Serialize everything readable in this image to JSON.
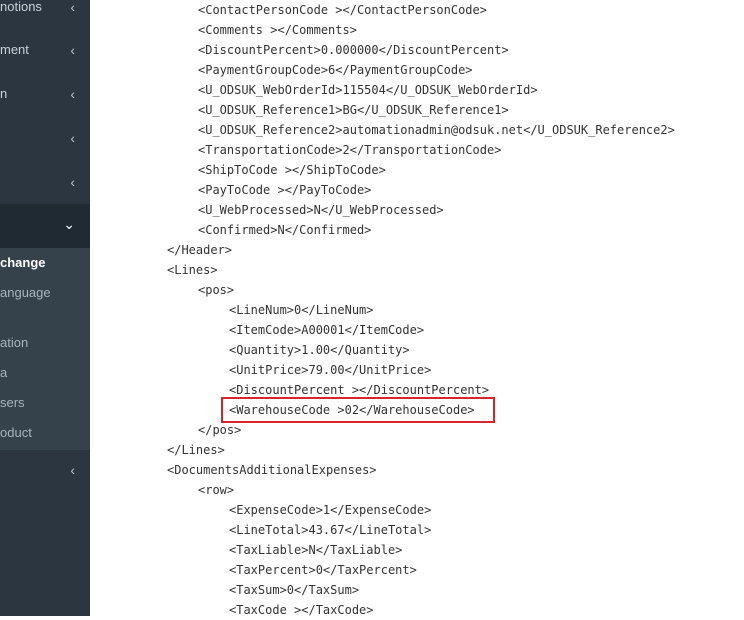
{
  "sidebar": {
    "items": [
      {
        "label": "notions"
      },
      {
        "label": "ment"
      },
      {
        "label": "n"
      },
      {
        "label": ""
      },
      {
        "label": ""
      },
      {
        "label": ""
      },
      {
        "label": ""
      }
    ],
    "submenu": [
      {
        "label": "change"
      },
      {
        "label": "anguage"
      },
      {
        "label": "ation"
      },
      {
        "label": "a"
      },
      {
        "label": "sers"
      },
      {
        "label": "oduct"
      }
    ]
  },
  "code_lines": [
    "<ContactPersonCode ></ContactPersonCode>",
    "<Comments ></Comments>",
    "<DiscountPercent>0.000000</DiscountPercent>",
    "<PaymentGroupCode>6</PaymentGroupCode>",
    "<U_ODSUK_WebOrderId>115504</U_ODSUK_WebOrderId>",
    "<U_ODSUK_Reference1>BG</U_ODSUK_Reference1>",
    "<U_ODSUK_Reference2>automationadmin@odsuk.net</U_ODSUK_Reference2>",
    "<TransportationCode>2</TransportationCode>",
    "<ShipToCode ></ShipToCode>",
    "<PayToCode ></PayToCode>",
    "<U_WebProcessed>N</U_WebProcessed>",
    "<Confirmed>N</Confirmed>",
    "</Header>",
    "<Lines>",
    "<pos>",
    "<LineNum>0</LineNum>",
    "<ItemCode>A00001</ItemCode>",
    "<Quantity>1.00</Quantity>",
    "<UnitPrice>79.00</UnitPrice>",
    "<DiscountPercent ></DiscountPercent>",
    "<WarehouseCode >02</WarehouseCode>",
    "</pos>",
    "</Lines>",
    "<DocumentsAdditionalExpenses>",
    "<row>",
    "<ExpenseCode>1</ExpenseCode>",
    "<LineTotal>43.67</LineTotal>",
    "<TaxLiable>N</TaxLiable>",
    "<TaxPercent>0</TaxPercent>",
    "<TaxSum>0</TaxSum>",
    "<TaxCode ></TaxCode>"
  ],
  "icons": {
    "collapsed": "chevron-left-icon",
    "expanded": "chevron-down-icon"
  },
  "colors": {
    "sidebar_bg": "#2b3640",
    "sidebar_active_bg": "#202a32",
    "submenu_bg": "#35414b",
    "highlight_border": "#d9262a",
    "code_text": "#333333"
  }
}
